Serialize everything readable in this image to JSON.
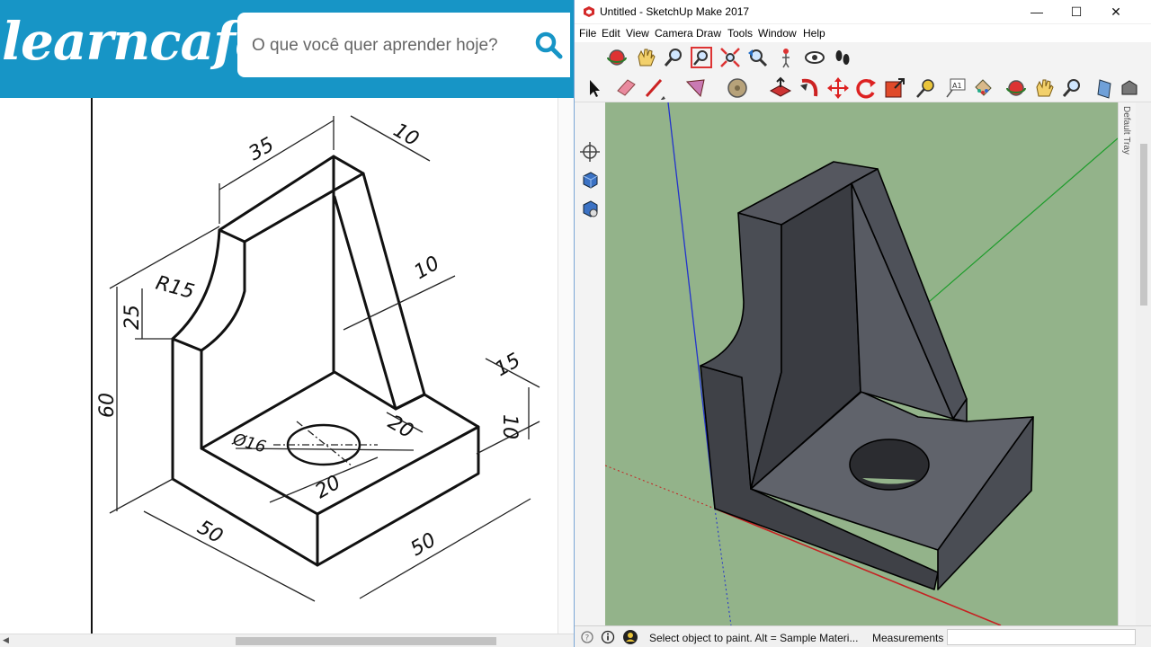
{
  "learncafe": {
    "logo_text": "learncafe",
    "search_placeholder": "O que você quer aprender hoje?",
    "brand_color": "#1795c6",
    "drawing_dimensions": [
      "35",
      "10",
      "10",
      "R15",
      "25",
      "60",
      "15",
      "10",
      "Ø16",
      "20",
      "20",
      "50",
      "50"
    ]
  },
  "sketchup": {
    "window_title": "Untitled - SketchUp Make 2017",
    "window_controls": {
      "minimize": "—",
      "maximize": "☐",
      "close": "✕"
    },
    "menus": [
      "File",
      "Edit",
      "View",
      "Camera",
      "Draw",
      "Tools",
      "Window",
      "Help"
    ],
    "toolbar_large": [
      "orbit-icon",
      "pan-icon",
      "zoom-icon",
      "zoom-window-icon",
      "zoom-extents-icon",
      "previous-view-icon",
      "position-camera-icon",
      "look-around-icon",
      "walk-icon"
    ],
    "toolbar_main": [
      "select-icon",
      "eraser-icon",
      "line-icon",
      "arc-icon",
      "shape-icon",
      "push-pull-icon",
      "follow-me-icon",
      "move-icon",
      "rotate-icon",
      "scale-icon",
      "tape-measure-icon",
      "text-icon",
      "paint-bucket-icon",
      "orbit-icon",
      "pan-icon",
      "zoom-icon",
      "section-icon",
      "warehouse-icon"
    ],
    "left_tools": [
      "axes-icon",
      "component-icon",
      "warehouse-icon"
    ],
    "tray_label": "Default Tray",
    "status_text": "Select object to paint. Alt = Sample Materi...",
    "measurements_label": "Measurements",
    "measurements_value": "",
    "viewport_color": "#93b38a",
    "model_color": "#5d6068"
  }
}
